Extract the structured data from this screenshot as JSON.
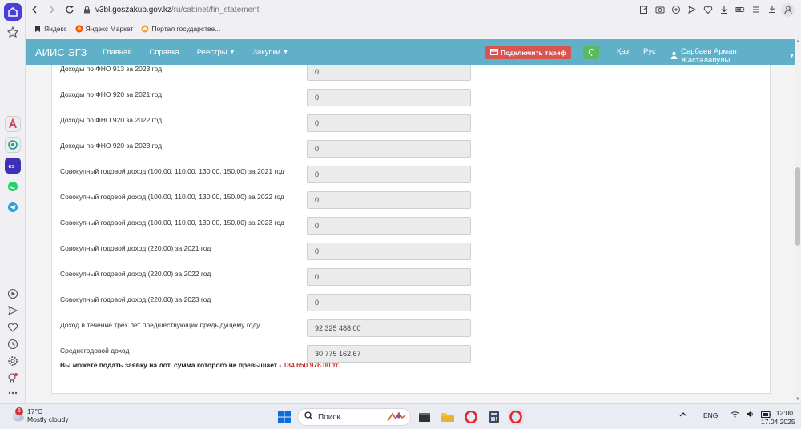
{
  "browser": {
    "url_host": "v3bl.goszakup.gov.kz",
    "url_path": "/ru/cabinet/fin_statement",
    "bookmarks": [
      {
        "label": "Яндекс"
      },
      {
        "label": "Яндекс Маркет"
      },
      {
        "label": "Портал государстве..."
      }
    ]
  },
  "navbar": {
    "brand": "АИИС ЭГЗ",
    "items": [
      {
        "label": "Главная",
        "has_caret": false
      },
      {
        "label": "Справка",
        "has_caret": false
      },
      {
        "label": "Реестры",
        "has_caret": true
      },
      {
        "label": "Закупки",
        "has_caret": true
      }
    ],
    "tariff_button": "Подключить тариф",
    "lang_kz": "Қаз",
    "lang_ru": "Рус",
    "user_name": "Сарбаев Арман Жасталапулы",
    "colors": {
      "bar": "#5fb0c8",
      "tariff": "#d9534f",
      "bell": "#5cb85c"
    }
  },
  "form": {
    "rows": [
      {
        "label": "Доходы по ФНО 913 за 2023 год",
        "value": "0"
      },
      {
        "label": "Доходы по ФНО 920 за 2021 год",
        "value": "0"
      },
      {
        "label": "Доходы по ФНО 920 за 2022 год",
        "value": "0"
      },
      {
        "label": "Доходы по ФНО 920 за 2023 год",
        "value": "0"
      },
      {
        "label": "Совокупный годовой доход (100.00, 110.00, 130.00, 150.00) за 2021 год",
        "value": "0"
      },
      {
        "label": "Совокупный годовой доход (100.00, 110.00, 130.00, 150.00) за 2022 год",
        "value": "0"
      },
      {
        "label": "Совокупный годовой доход (100.00, 110.00, 130.00, 150.00) за 2023 год",
        "value": "0"
      },
      {
        "label": "Совокупный годовой доход (220.00) за 2021 год",
        "value": "0"
      },
      {
        "label": "Совокупный годовой доход (220.00) за 2022 год",
        "value": "0"
      },
      {
        "label": "Совокупный годовой доход (220.00) за 2023 год",
        "value": "0"
      },
      {
        "label": "Доход в течение трех лет предшествующих предыдущему году",
        "value": "92 325 488.00"
      },
      {
        "label": "Среднегодовой доход",
        "value": "30 775 162.67"
      }
    ],
    "limit_text": "Вы можете подать заявку на лот, сумма которого не превышает - ",
    "limit_amount": "184 650 976.00 тг",
    "limit_color": "#c9302c"
  },
  "taskbar": {
    "weather_temp": "17°C",
    "weather_desc": "Mostly cloudy",
    "weather_badge": "5",
    "search_placeholder": "Поиск",
    "language": "ENG",
    "time": "12:00",
    "date": "17.04.2025"
  }
}
